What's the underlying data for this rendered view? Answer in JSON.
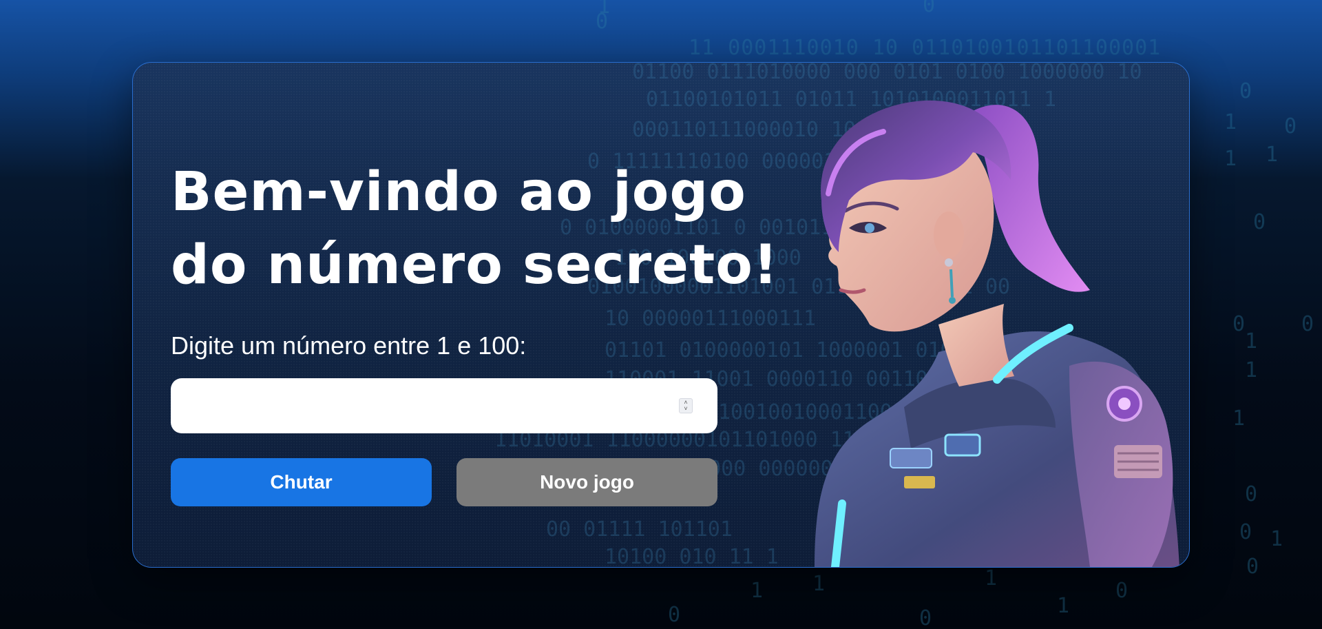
{
  "header": {
    "title_line1": "Bem-vindo ao jogo",
    "title_line2": "do número secreto!"
  },
  "form": {
    "prompt": "Digite um número entre 1 e 100:",
    "input_value": "",
    "input_placeholder": ""
  },
  "buttons": {
    "guess_label": "Chutar",
    "new_game_label": "Novo jogo"
  },
  "background_binary": [
    "11 0001110010 10 0110100101101100001",
    "01100 0111010000 000 0101 0100 1000000 10",
    "01100101011 01011 1010100011011 1",
    "000110111000010 1011010000010",
    "0 11111110100 0000011 0 0",
    "0 01000001101 0 001011",
    "100 100100 1000",
    "01001000001101001 01101 0100011 00",
    "10 00000111000111",
    "01101 0100000101 1000001 01000",
    "110001 11001 0000110 00110",
    "1001001000110000",
    "11010001 11000000101101000 11 100",
    "00000 000000",
    "00 01111 101101",
    "10100 010 11 1"
  ],
  "colors": {
    "primary_button": "#1875e4",
    "secondary_button": "#7b7b7b",
    "card_border": "#2a6fd0",
    "text": "#ffffff"
  },
  "icons": {
    "spinner": "number-spinner-icon",
    "illustration": "astronaut-girl-illustration"
  }
}
